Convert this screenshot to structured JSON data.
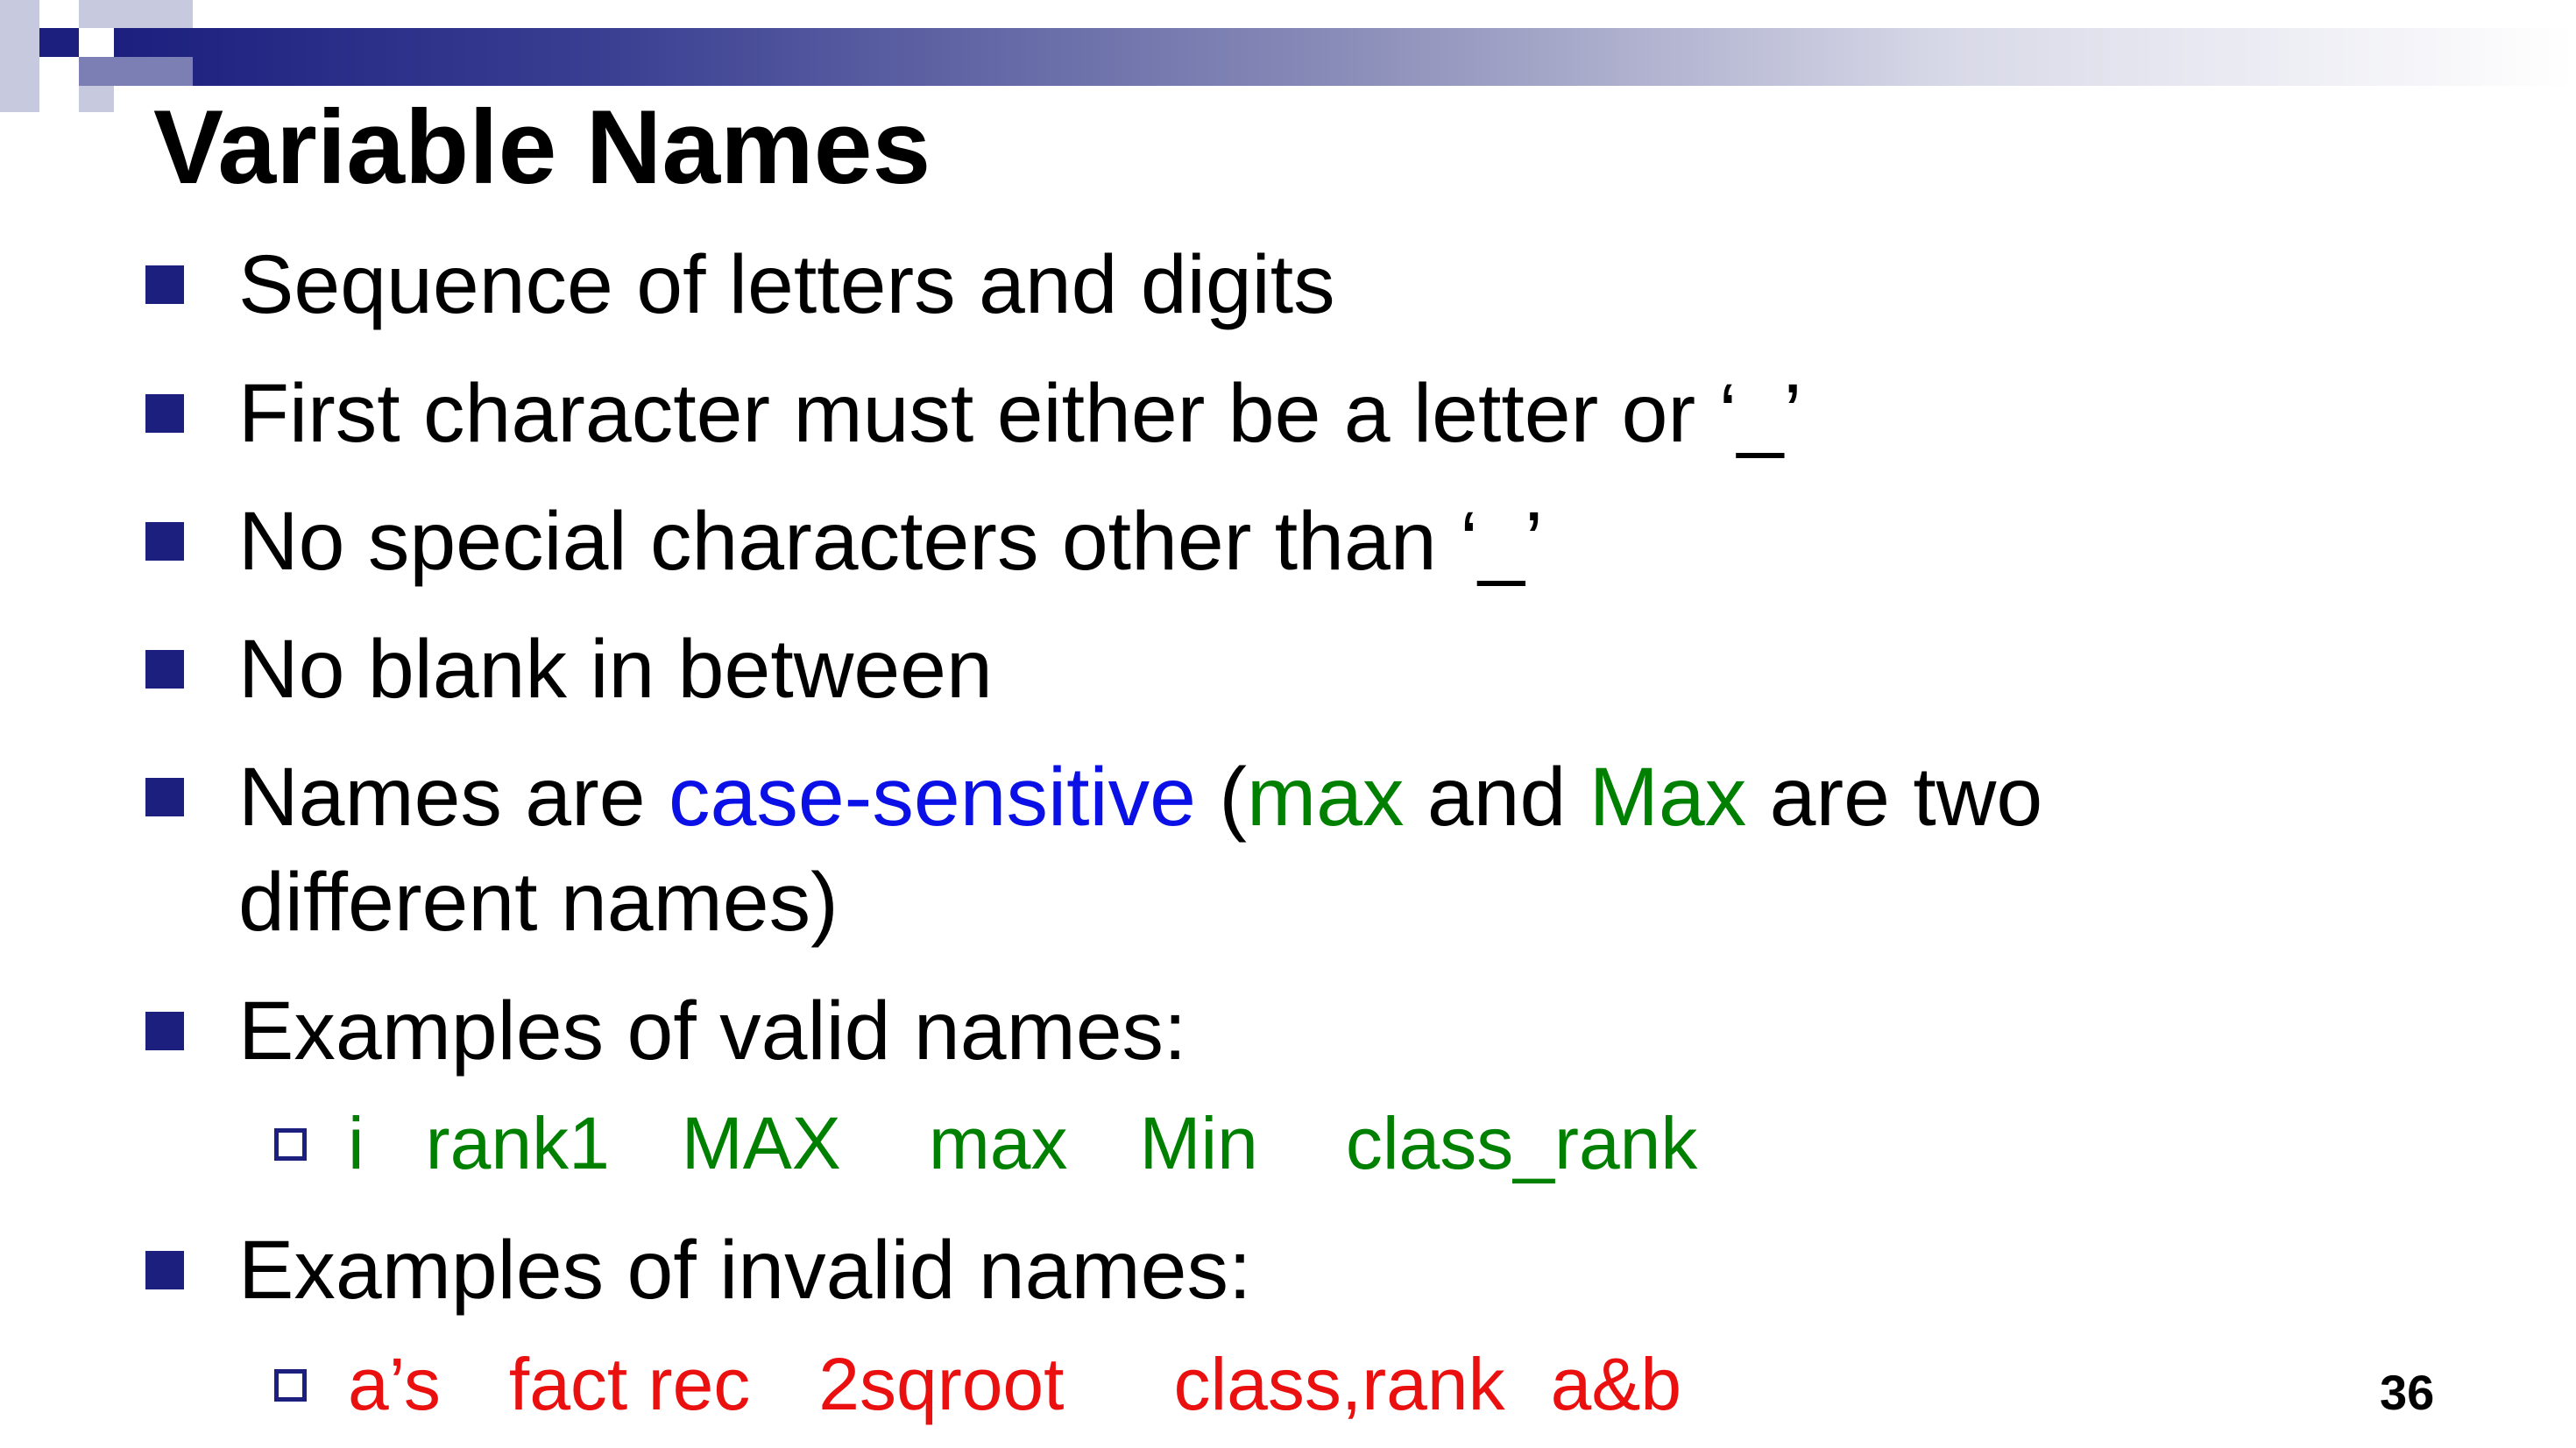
{
  "slide": {
    "title": "Variable Names",
    "page_number": "36",
    "colors": {
      "accent": "#1c1f7e",
      "highlight_blue": "#0a10e6",
      "highlight_green": "#008000",
      "highlight_red": "#ea1010"
    }
  },
  "bullets": [
    {
      "text": "Sequence of letters and digits"
    },
    {
      "text": "First character must either be a letter or ‘_’"
    },
    {
      "text": "No special characters other than ‘_’"
    },
    {
      "text": "No blank in between"
    },
    {
      "part1": "Names are ",
      "case_sensitive": "case-sensitive",
      "part2": " (",
      "example_lower": "max",
      "part3": " and ",
      "example_upper": "Max",
      "part4": " are two",
      "line2": "different names)"
    },
    {
      "text": "Examples of valid names:",
      "examples": [
        "i",
        "rank1",
        "MAX",
        "max",
        "Min",
        "class_rank"
      ]
    },
    {
      "text": "Examples of invalid names:",
      "examples": [
        "a’s",
        "fact rec",
        "2sqroot",
        "class,rank",
        "a&b"
      ]
    }
  ]
}
